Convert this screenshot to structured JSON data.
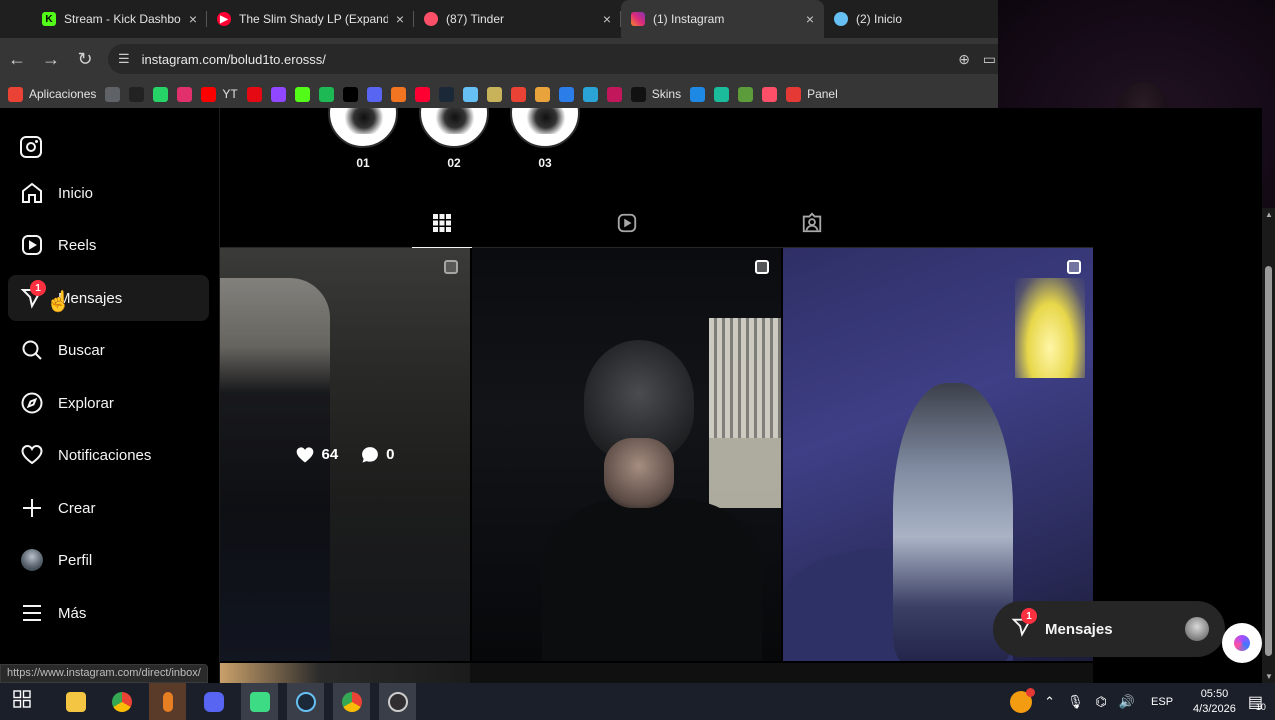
{
  "browser": {
    "tabs": [
      {
        "title": "Stream - Kick Dashboard",
        "favicon": "kick-icon",
        "color": "#53fc18",
        "active": false
      },
      {
        "title": "The Slim Shady LP (Expanded",
        "favicon": "youtube-music-icon",
        "color": "#ff0033",
        "active": false
      },
      {
        "title": "(87) Tinder",
        "favicon": "tinder-icon",
        "color": "#fd5068",
        "active": false
      },
      {
        "title": "(1) Instagram",
        "favicon": "instagram-icon",
        "color": "#e1306c",
        "active": true
      },
      {
        "title": "(2) Inicio",
        "favicon": "steam-inicio-icon",
        "color": "#66c0f4",
        "active": false
      }
    ],
    "close_glyph": "×",
    "url": "instagram.com/bolud1to.erosss/",
    "bookmarks": [
      {
        "label": "Aplicaciones",
        "icon": "apps-grid-icon",
        "color": "#ea4335"
      },
      {
        "label": "",
        "icon": "grid-icon",
        "color": "#5f6368"
      },
      {
        "label": "",
        "icon": "github-icon",
        "color": "#222"
      },
      {
        "label": "",
        "icon": "whatsapp-icon",
        "color": "#25d366"
      },
      {
        "label": "",
        "icon": "instagram-icon",
        "color": "#e1306c"
      },
      {
        "label": "YT",
        "icon": "youtube-icon",
        "color": "#ff0000"
      },
      {
        "label": "",
        "icon": "netflix-icon",
        "color": "#e50914"
      },
      {
        "label": "",
        "icon": "twitch-icon",
        "color": "#9146ff"
      },
      {
        "label": "",
        "icon": "kick-icon",
        "color": "#53fc18"
      },
      {
        "label": "",
        "icon": "spotify-icon",
        "color": "#1db954"
      },
      {
        "label": "",
        "icon": "x-icon",
        "color": "#000"
      },
      {
        "label": "",
        "icon": "discord-icon",
        "color": "#5865f2"
      },
      {
        "label": "",
        "icon": "crunchyroll-icon",
        "color": "#f47521"
      },
      {
        "label": "",
        "icon": "youtube-music-icon",
        "color": "#ff0033"
      },
      {
        "label": "",
        "icon": "steam-icon",
        "color": "#1b2838"
      },
      {
        "label": "",
        "icon": "steam-community-icon",
        "color": "#66c0f4"
      },
      {
        "label": "",
        "icon": "eye-icon",
        "color": "#c8b35a"
      },
      {
        "label": "",
        "icon": "gmail-icon",
        "color": "#ea4335"
      },
      {
        "label": "",
        "icon": "cs-icon",
        "color": "#e8a33d"
      },
      {
        "label": "",
        "icon": "cloud-icon",
        "color": "#2b7de9"
      },
      {
        "label": "",
        "icon": "tl-icon",
        "color": "#2aa3d6"
      },
      {
        "label": "",
        "icon": "game-icon",
        "color": "#c2185b"
      },
      {
        "label": "Skins",
        "icon": "skins-icon",
        "color": "#111"
      },
      {
        "label": "",
        "icon": "m-icon",
        "color": "#1e88e5"
      },
      {
        "label": "",
        "icon": "circle-icon",
        "color": "#1abc9c"
      },
      {
        "label": "",
        "icon": "minecraft-icon",
        "color": "#5d9c3a"
      },
      {
        "label": "",
        "icon": "tinder-icon",
        "color": "#fd5068"
      },
      {
        "label": "Panel",
        "icon": "p-icon",
        "color": "#e53935"
      }
    ]
  },
  "sidebar": {
    "items": [
      {
        "label": "Inicio",
        "icon": "home-icon"
      },
      {
        "label": "Reels",
        "icon": "reels-icon"
      },
      {
        "label": "Mensajes",
        "icon": "messenger-icon",
        "badge": "1"
      },
      {
        "label": "Buscar",
        "icon": "search-icon"
      },
      {
        "label": "Explorar",
        "icon": "explore-icon"
      },
      {
        "label": "Notificaciones",
        "icon": "heart-icon"
      },
      {
        "label": "Crear",
        "icon": "plus-icon"
      },
      {
        "label": "Perfil",
        "icon": "profile-avatar"
      },
      {
        "label": "Más",
        "icon": "menu-icon"
      }
    ]
  },
  "highlights": [
    {
      "label": "01"
    },
    {
      "label": "02"
    },
    {
      "label": "03"
    }
  ],
  "profile_tabs": [
    {
      "name": "posts",
      "icon": "grid-icon",
      "active": true
    },
    {
      "name": "reels",
      "icon": "reels-icon",
      "active": false
    },
    {
      "name": "tagged",
      "icon": "tagged-icon",
      "active": false
    }
  ],
  "posts": [
    {
      "likes": "64",
      "comments": "0",
      "hovered": true
    },
    {
      "hovered": false
    },
    {
      "hovered": false
    }
  ],
  "messages_pill": {
    "label": "Mensajes",
    "badge": "1"
  },
  "status_url": "https://www.instagram.com/direct/inbox/",
  "taskbar": {
    "apps": [
      "start-icon",
      "file-explorer-icon",
      "chrome-icon",
      "mic-icon",
      "discord-icon",
      "android-icon",
      "steam-icon",
      "chrome-alt-icon",
      "obs-icon"
    ],
    "language": "ESP",
    "time": "05:50",
    "date": "4/3/2026",
    "notifications": "10"
  }
}
